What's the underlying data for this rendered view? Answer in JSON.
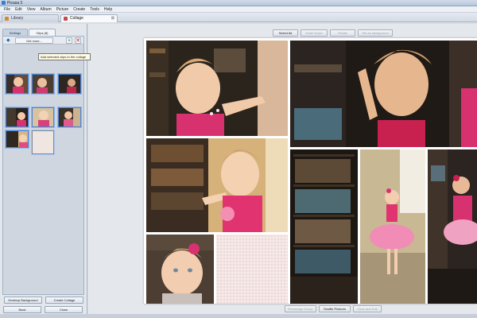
{
  "app": {
    "title": "Picasa 3",
    "icon": "picasa-app-icon"
  },
  "menu": [
    "File",
    "Edit",
    "View",
    "Album",
    "Picture",
    "Create",
    "Tools",
    "Help"
  ],
  "tabs": [
    {
      "label": "Library",
      "icon": "library-icon",
      "active": false
    },
    {
      "label": "Collage",
      "icon": "collage-icon",
      "active": true,
      "close": "⊠"
    }
  ],
  "left_panel": {
    "tabs": {
      "settings": "Settings",
      "clips": "Clips (8)"
    },
    "get_more": "Get more...",
    "add_symbol": "+",
    "remove_symbol": "✕",
    "back_symbol": "◆",
    "tooltip": "Add selected clips to the collage",
    "buttons": {
      "desktop_background": "Desktop Background",
      "create_collage": "Create Collage",
      "back": "Back",
      "close": "Close"
    }
  },
  "toolbar": {
    "select_all": "Select All",
    "disabled_1": "Scale Down",
    "disabled_2": "Rotate",
    "disabled_3": "Set as background"
  },
  "bottom_toolbar": {
    "left": "Rearrange Group",
    "shuffle": "Shuffle Pictures",
    "right": "Clear and Edit"
  },
  "colors": {
    "dress_pink": "#d8316f",
    "bookshelf_dark": "#2b241c",
    "wall_warm": "#d6b27a",
    "selection_blue": "#4b84d6"
  }
}
